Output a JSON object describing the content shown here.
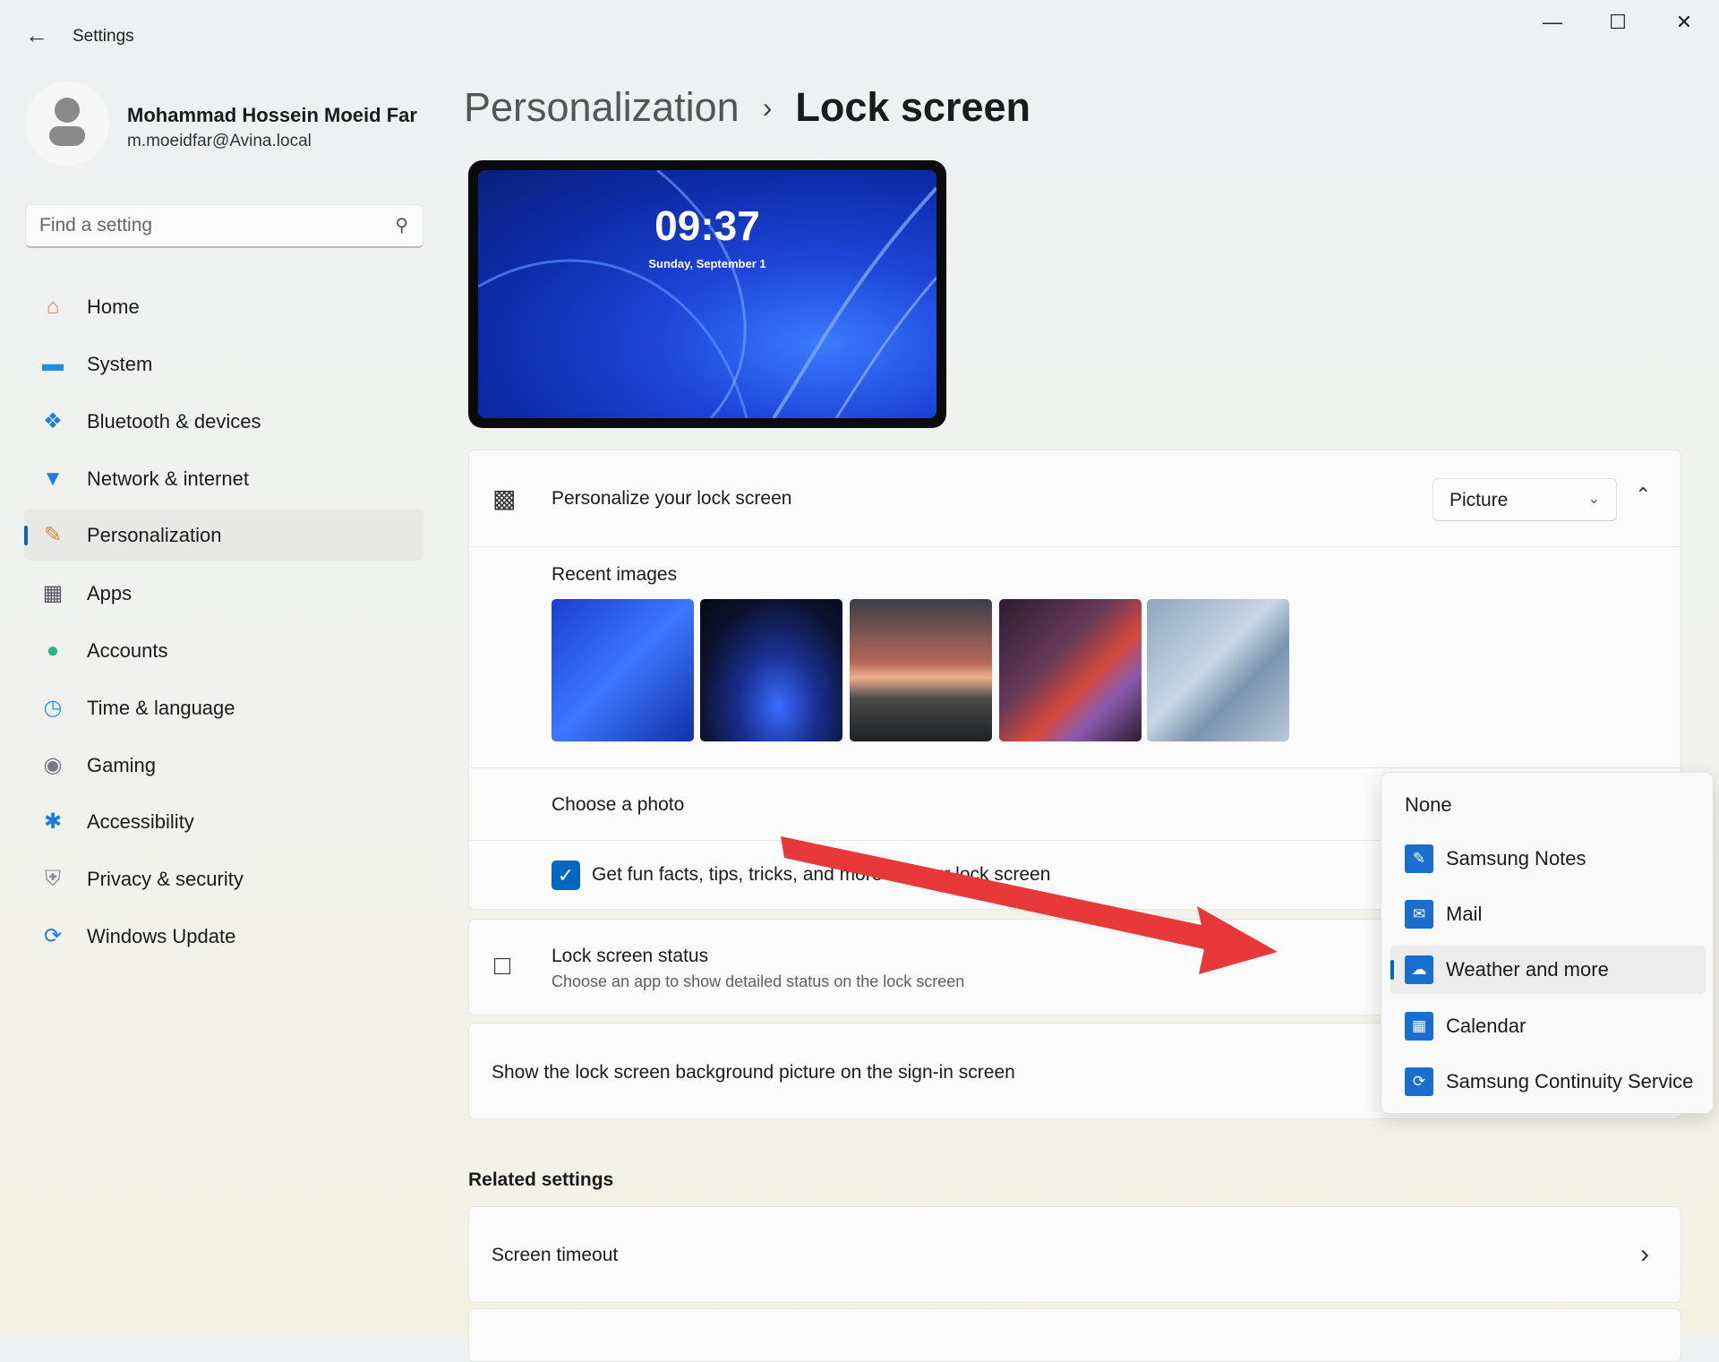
{
  "window": {
    "title": "Settings",
    "back_icon": "arrow-left-icon",
    "controls": [
      "minimize-icon",
      "maximize-icon",
      "close-icon"
    ]
  },
  "user": {
    "name": "Mohammad Hossein Moeid Far",
    "email": "m.moeidfar@Avina.local"
  },
  "search": {
    "placeholder": "Find a setting"
  },
  "sidebar": {
    "items": [
      {
        "label": "Home",
        "icon": "home-icon"
      },
      {
        "label": "System",
        "icon": "monitor-icon"
      },
      {
        "label": "Bluetooth & devices",
        "icon": "bluetooth-icon"
      },
      {
        "label": "Network & internet",
        "icon": "wifi-icon"
      },
      {
        "label": "Personalization",
        "icon": "brush-icon",
        "selected": true
      },
      {
        "label": "Apps",
        "icon": "apps-icon"
      },
      {
        "label": "Accounts",
        "icon": "person-icon"
      },
      {
        "label": "Time & language",
        "icon": "globe-clock-icon"
      },
      {
        "label": "Gaming",
        "icon": "gamepad-icon"
      },
      {
        "label": "Accessibility",
        "icon": "accessibility-icon"
      },
      {
        "label": "Privacy & security",
        "icon": "shield-icon"
      },
      {
        "label": "Windows Update",
        "icon": "update-icon"
      }
    ]
  },
  "breadcrumb": {
    "parent": "Personalization",
    "current": "Lock screen"
  },
  "preview": {
    "time": "09:37",
    "date": "Sunday, September 1"
  },
  "personalize": {
    "label": "Personalize your lock screen",
    "value": "Picture",
    "recent_label": "Recent images",
    "choose_photo": "Choose a photo",
    "fun_facts": "Get fun facts, tips, tricks, and more on your lock screen",
    "fun_facts_checked": true
  },
  "status": {
    "title": "Lock screen status",
    "subtitle": "Choose an app to show detailed status on the lock screen"
  },
  "signin": {
    "label": "Show the lock screen background picture on the sign-in screen"
  },
  "related": {
    "heading": "Related settings",
    "screen_timeout": "Screen timeout"
  },
  "menu": {
    "items": [
      {
        "label": "None"
      },
      {
        "label": "Samsung Notes",
        "icon": "samsung-notes-icon"
      },
      {
        "label": "Mail",
        "icon": "mail-icon"
      },
      {
        "label": "Weather and more",
        "icon": "weather-icon",
        "selected": true
      },
      {
        "label": "Calendar",
        "icon": "calendar-icon"
      },
      {
        "label": "Samsung Continuity Service",
        "icon": "samsung-continuity-icon"
      }
    ]
  },
  "colors": {
    "accent": "#0067c0",
    "arrow": "#e8383a"
  }
}
